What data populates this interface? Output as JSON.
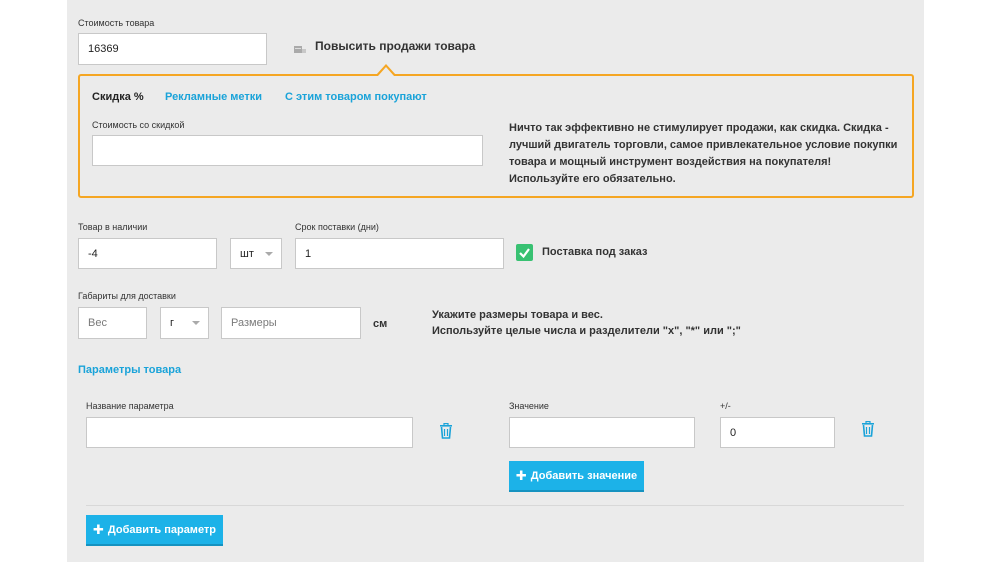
{
  "price": {
    "label": "Стоимость товара",
    "value": "16369"
  },
  "promo": {
    "title": "Повысить продажи товара",
    "tabs": [
      {
        "label": "Скидка %"
      },
      {
        "label": "Рекламные метки"
      },
      {
        "label": "С этим товаром покупают"
      }
    ],
    "discount_label": "Стоимость со скидкой",
    "discount_value": "",
    "description": "Ничто так эффективно не стимулирует продажи, как скидка. Скидка - лучший двигатель торговли, самое привлекательное условие покупки товара и мощный инструмент воздействия на покупателя! Используйте его обязательно."
  },
  "stock": {
    "label": "Товар в наличии",
    "value": "-4",
    "unit": "шт"
  },
  "delivery": {
    "label": "Срок поставки (дни)",
    "value": "1",
    "on_order_label": "Поставка под заказ"
  },
  "dimensions": {
    "label": "Габариты для доставки",
    "weight_placeholder": "Вес",
    "weight_unit": "г",
    "size_placeholder": "Размеры",
    "size_unit": "см",
    "hint_line1": "Укажите размеры товара и вес.",
    "hint_line2": "Используйте целые числа и разделители \"x\", \"*\" или \";\""
  },
  "params": {
    "title": "Параметры товара",
    "name_label": "Название параметра",
    "value_label": "Значение",
    "delta_label": "+/-",
    "delta_value": "0",
    "add_value_label": "Добавить значение",
    "add_param_label": "Добавить параметр"
  },
  "colors": {
    "accent": "#1cb2e8",
    "link": "#1aa3d9",
    "promo_border": "#f5a623",
    "check": "#38c172"
  }
}
